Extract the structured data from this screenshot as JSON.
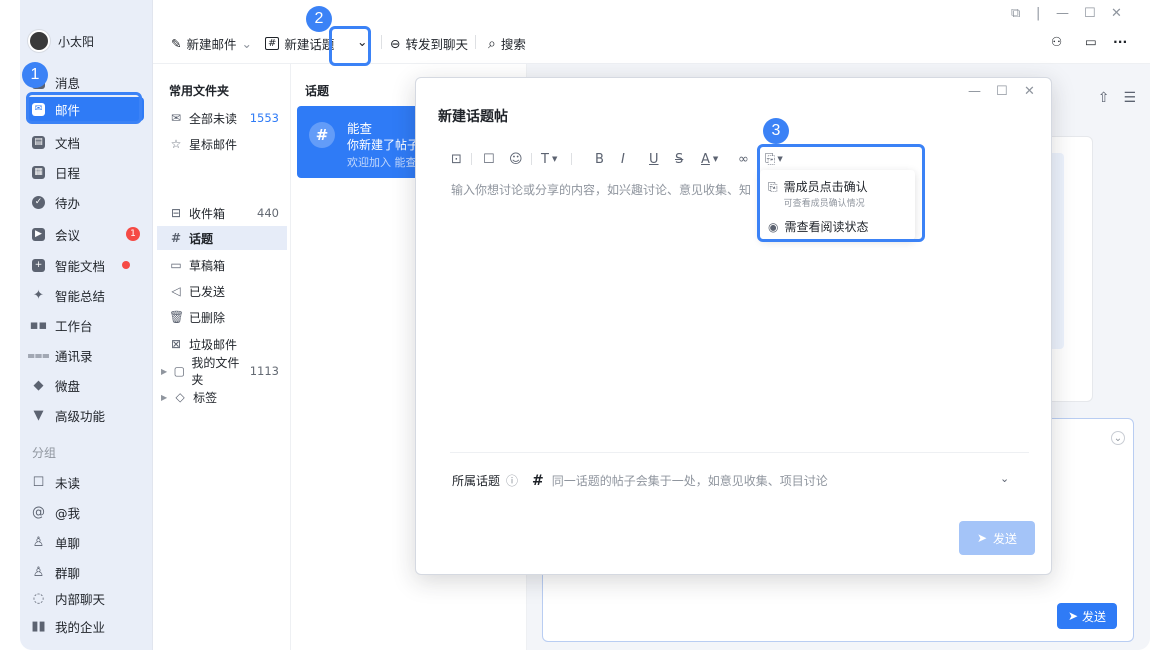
{
  "user": {
    "name": "小太阳"
  },
  "nav": {
    "items": [
      {
        "label": "消息",
        "icon": "chat-icon"
      },
      {
        "label": "邮件",
        "icon": "mail-icon"
      },
      {
        "label": "文档",
        "icon": "doc-icon"
      },
      {
        "label": "日程",
        "icon": "calendar-icon"
      },
      {
        "label": "待办",
        "icon": "check-icon"
      },
      {
        "label": "会议",
        "icon": "meeting-icon",
        "badge": "1"
      },
      {
        "label": "智能文档",
        "icon": "smart-doc-icon"
      },
      {
        "label": "智能总结",
        "icon": "sparkle-icon"
      },
      {
        "label": "工作台",
        "icon": "grid-icon"
      },
      {
        "label": "通讯录",
        "icon": "contacts-icon"
      },
      {
        "label": "微盘",
        "icon": "disk-icon"
      },
      {
        "label": "高级功能",
        "icon": "advanced-icon"
      }
    ],
    "group_label": "分组",
    "group_items": [
      {
        "label": "未读",
        "icon": "unread-icon"
      },
      {
        "label": "@我",
        "icon": "at-icon"
      },
      {
        "label": "单聊",
        "icon": "person-icon"
      },
      {
        "label": "群聊",
        "icon": "group-icon"
      },
      {
        "label": "内部聊天",
        "icon": "inner-chat-icon"
      },
      {
        "label": "我的企业",
        "icon": "company-icon"
      }
    ]
  },
  "toolbar": {
    "new_mail": "新建邮件",
    "new_topic": "新建话题",
    "forward": "转发到聊天",
    "search": "搜索"
  },
  "folders": {
    "header": "常用文件夹",
    "items": [
      {
        "label": "全部未读",
        "count": "1553",
        "icon": "✉"
      },
      {
        "label": "星标邮件",
        "count": "",
        "icon": "☆"
      }
    ],
    "mailbox": [
      {
        "label": "收件箱",
        "count": "440",
        "icon": "⊟"
      },
      {
        "label": "话题",
        "count": "",
        "icon": "#"
      },
      {
        "label": "草稿箱",
        "count": "",
        "icon": "▭"
      },
      {
        "label": "已发送",
        "count": "",
        "icon": "◁"
      },
      {
        "label": "已删除",
        "count": "",
        "icon": "🗑"
      },
      {
        "label": "垃圾邮件",
        "count": "",
        "icon": "⊠"
      },
      {
        "label": "我的文件夹",
        "count": "1113",
        "icon": "▢"
      },
      {
        "label": "标签",
        "count": "",
        "icon": "◇"
      }
    ]
  },
  "topics": {
    "header": "话题",
    "card": {
      "title": "能查",
      "line1": "你新建了帖子",
      "line2": "欢迎加入 能查"
    }
  },
  "modal": {
    "title": "新建话题帖",
    "placeholder": "输入你想讨论或分享的内容，如兴趣讨论、意见收集、知识分享",
    "topic_label": "所属话题",
    "topic_hint": "同一话题的帖子会集于一处，如意见收集、项目讨论",
    "send": "发送",
    "toolbar_text": {
      "font": "T",
      "bold": "B",
      "italic": "I",
      "underline": "U",
      "strike": "S",
      "color": "A"
    }
  },
  "dropdown": {
    "items": [
      {
        "label": "需成员点击确认",
        "sub": "可查看成员确认情况"
      },
      {
        "label": "需查看阅读状态",
        "sub": ""
      }
    ]
  },
  "right_panel": {
    "send": "发送"
  },
  "steps": [
    "1",
    "2",
    "3"
  ]
}
